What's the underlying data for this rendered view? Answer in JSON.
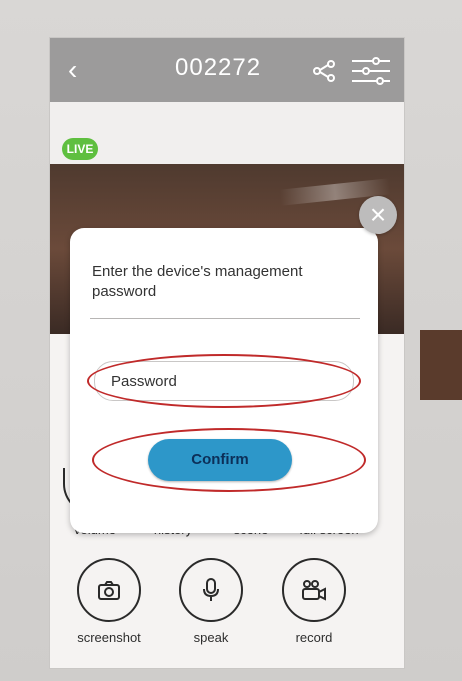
{
  "header": {
    "back_icon": "chevron-left-icon",
    "device_id": "002272",
    "share_icon": "share-icon",
    "settings_icon": "sliders-icon"
  },
  "status": {
    "live_label": "LIVE",
    "live_color": "#5fbf3f"
  },
  "dialog": {
    "close_icon": "close-icon",
    "prompt": "Enter the device's management password",
    "password_placeholder": "Password",
    "confirm_label": "Confirm",
    "confirm_color": "#2d97c9",
    "annotation_color": "#c02a2a"
  },
  "controls": [
    {
      "label": "volume",
      "icon": "volume-icon"
    },
    {
      "label": "history",
      "icon": "history-icon"
    },
    {
      "label": "scene",
      "icon": "scene-icon"
    },
    {
      "label": "full screen",
      "icon": "fullscreen-icon"
    },
    {
      "label": "screenshot",
      "icon": "camera-icon"
    },
    {
      "label": "speak",
      "icon": "microphone-icon"
    },
    {
      "label": "record",
      "icon": "video-camera-icon"
    }
  ]
}
